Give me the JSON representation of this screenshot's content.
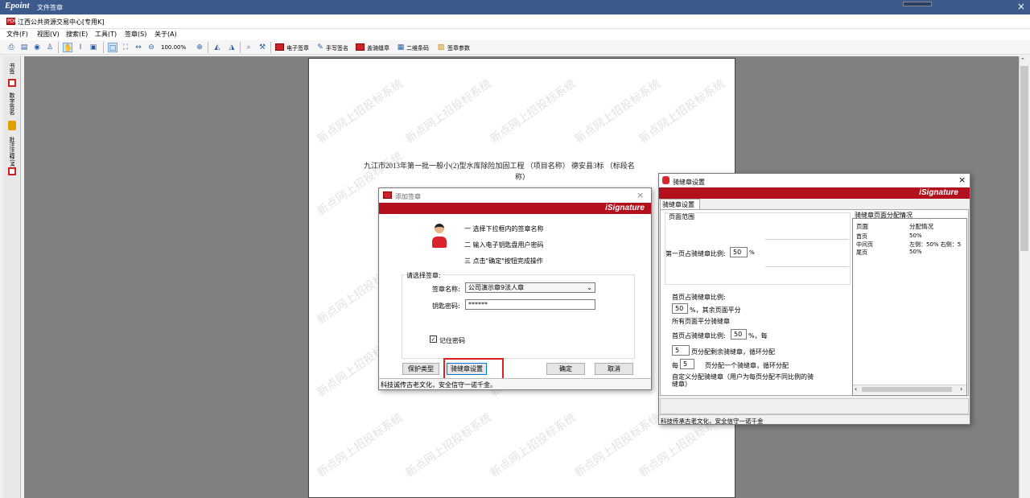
{
  "app": {
    "logo": "Epoint",
    "title": "文件签章",
    "close": "×"
  },
  "doc": {
    "title": "江西公共资源交易中心[专用K]",
    "icon": "PDF"
  },
  "menu": [
    "文件(F)",
    "视图(V)",
    "搜索(E)",
    "工具(T)",
    "签章(S)",
    "关于(A)"
  ],
  "toolbar": {
    "zoom": "100.00%",
    "electronic_seal": "电子签章",
    "handwrite_sign": "手写签名",
    "riding_seal": "盖骑缝章",
    "qrcode": "二维条码",
    "seal_params": "签章参数"
  },
  "sidebar": {
    "bookmark": "书签",
    "digital_sign": "数字签名",
    "annotation": "批注注释(M)"
  },
  "page": {
    "watermark": "新点网上招投标系统",
    "line1": "九江市2013年第一批一般小(2)型水库除险加固工程 （项目名称） 德安县3标 （标段名",
    "line2": "称）"
  },
  "add_seal": {
    "title": "添加签章",
    "brand": "iSignature",
    "steps": [
      "一 选择下拉框内的签章名称",
      "二 输入电子钥匙盘用户密码",
      "三 点击\"确定\"按钮完成操作"
    ],
    "group_label": "请选择签章:",
    "name_label": "签章名称:",
    "name_value": "公司演示章9法人章",
    "pwd_label": "钥匙密码:",
    "pwd_value": "******",
    "remember": "记住密码",
    "remember_checked": true,
    "btn_protect": "保护类型",
    "btn_riding": "骑缝章设置",
    "btn_ok": "确定",
    "btn_cancel": "取消",
    "status": "科技诚传古老文化，安全信守一诺千金。",
    "highlight_color": "#e02020"
  },
  "riding": {
    "title": "骑缝章设置",
    "brand": "iSignature",
    "tab": "骑缝章设置",
    "range_label": "页面范围",
    "first_ratio_label": "第一页占骑缝章比例:",
    "first_ratio_value": "50",
    "percent": "%",
    "head_ratio_label": "首页占骑缝章比例:",
    "head_ratio_value": "50",
    "head_ratio_suffix": "%，其余页面平分",
    "all_pages": "所有页面平分骑缝章",
    "head_ratio2_label": "首页占骑缝章比例:",
    "head_ratio2_value": "50",
    "head_ratio2_suffix": "%，每",
    "pages_value": "5",
    "pages_suffix": "页分配剩余骑缝章，循环分配",
    "each_prefix": "每",
    "each_value": "5",
    "each_suffix": "页分配一个骑缝章，循环分配",
    "custom": "自定义分配骑缝章（用户为每页分配不同比例的骑缝章）",
    "dist_title": "骑缝章页面分配情况",
    "dist_headers": [
      "页面",
      "分配情况"
    ],
    "dist_rows": [
      {
        "page": "首页",
        "alloc": "50%"
      },
      {
        "page": "中间页",
        "alloc": "左侧：50%  右侧：5"
      },
      {
        "page": "尾页",
        "alloc": "50%"
      }
    ],
    "status": "科技传承古老文化，安全信守一诺千金",
    "close": "×"
  }
}
